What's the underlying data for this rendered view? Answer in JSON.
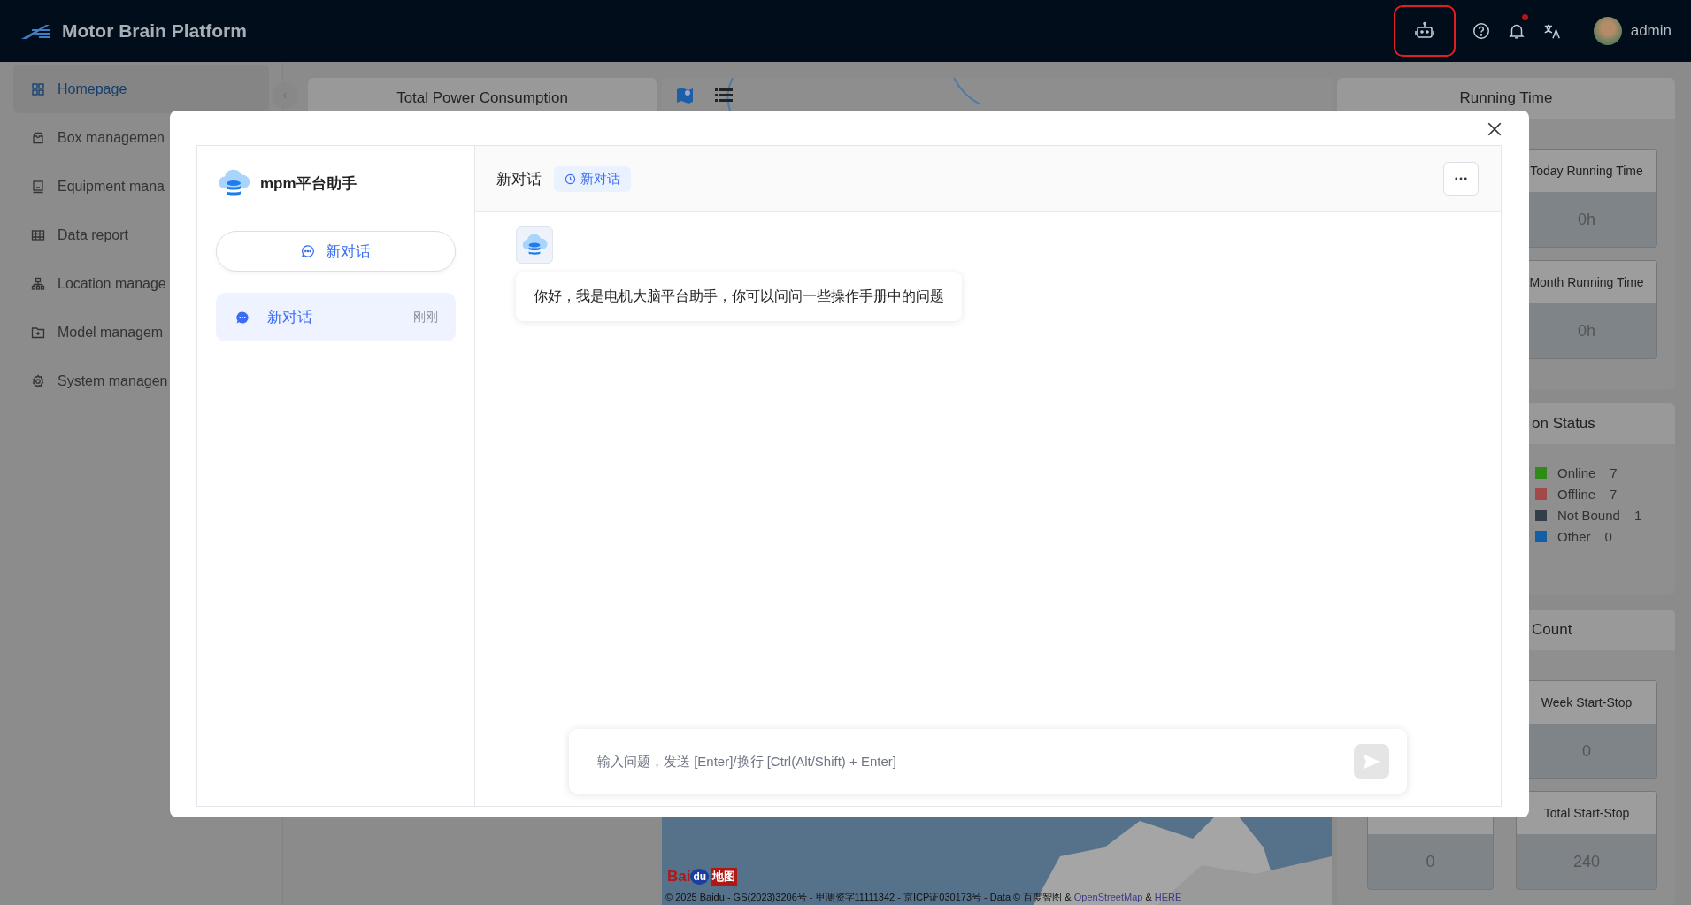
{
  "header": {
    "title": "Motor Brain Platform",
    "notification_dot": true,
    "user": "admin"
  },
  "sidebar": {
    "items": [
      {
        "label": "Homepage",
        "kind": "grid",
        "selected": true
      },
      {
        "label": "Box managemen",
        "kind": "box",
        "selected": false
      },
      {
        "label": "Equipment mana",
        "kind": "device",
        "selected": false
      },
      {
        "label": "Data report",
        "kind": "table",
        "selected": false
      },
      {
        "label": "Location manage",
        "kind": "org",
        "selected": false
      },
      {
        "label": "Model managem",
        "kind": "folder",
        "selected": false
      },
      {
        "label": "System managen",
        "kind": "gear",
        "selected": false
      }
    ]
  },
  "power_card": {
    "title": "Total Power Consumption"
  },
  "map": {
    "logo": {
      "left": "Bai",
      "paw": "du",
      "right": "地图"
    },
    "copyright": "© 2025 Baidu - GS(2023)3206号 - 甲测资字11111342 - 京ICP证030173号 - Data © 百度智图 & ",
    "links": [
      "OpenStreetMap",
      "HERE"
    ],
    "link_separator": "&"
  },
  "running_time": {
    "title": "Running Time",
    "stats": [
      {
        "label": "Today Running Time",
        "value": "0h"
      },
      {
        "label": "Month Running Time",
        "value": "0h"
      }
    ]
  },
  "status": {
    "title": "on Status",
    "legend": [
      {
        "label": "Online",
        "count": "7",
        "color": "#2f8a17"
      },
      {
        "label": "Offline",
        "count": "7",
        "color": "#a24a4a"
      },
      {
        "label": "Not Bound",
        "count": "1",
        "color": "#333e48"
      },
      {
        "label": "Other",
        "count": "0",
        "color": "#135fa6"
      }
    ]
  },
  "start_stop": {
    "title": "Count",
    "stats": [
      {
        "label": "Week Start-Stop",
        "value": "0"
      },
      {
        "value": "0"
      },
      {
        "label": "Total Start-Stop",
        "value": "240"
      }
    ]
  },
  "dialog": {
    "assistant_name": "mpm平台助手",
    "new_chat_button": "新对话",
    "conversations": [
      {
        "title": "新对话",
        "time": "刚刚",
        "selected": true
      }
    ],
    "chat_title": "新对话",
    "chat_tag": "新对话",
    "messages": [
      {
        "text": "你好，我是电机大脑平台助手，你可以问问一些操作手册中的问题"
      }
    ],
    "input": {
      "placeholder": "输入问题，发送 [Enter]/换行 [Ctrl(Alt/Shift) + Enter]"
    }
  }
}
